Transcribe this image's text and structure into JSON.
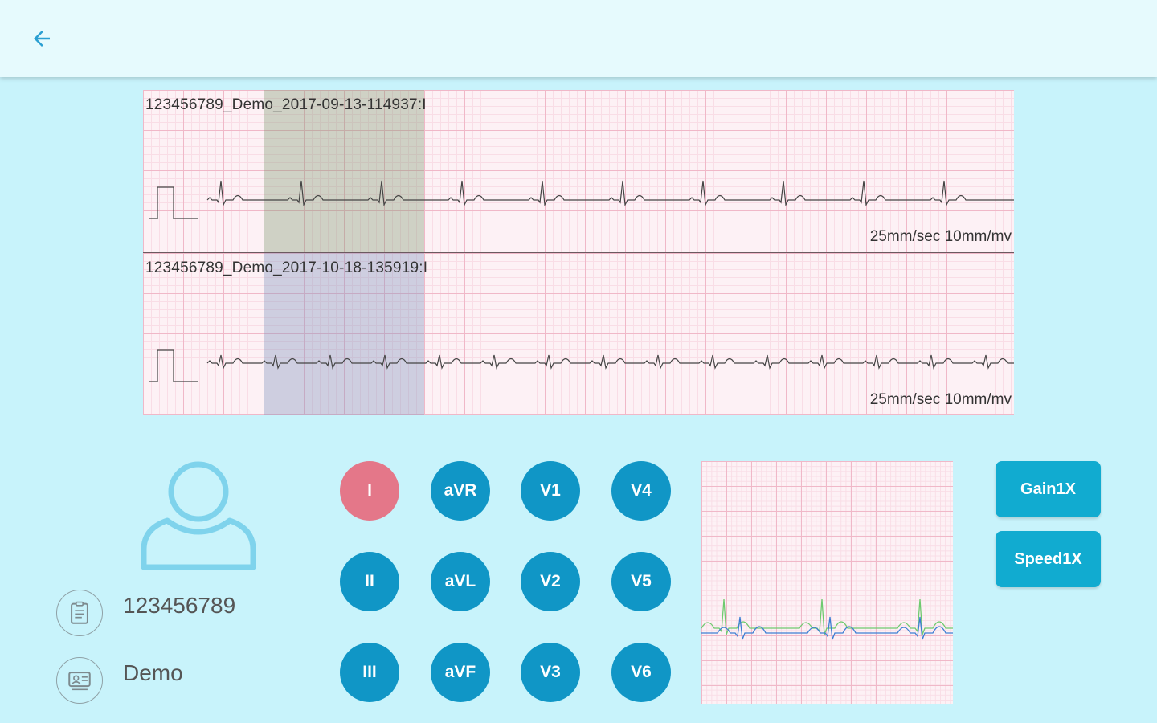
{
  "toolbar": {
    "back_icon": "arrow-left-icon"
  },
  "recordings": [
    {
      "label": "123456789_Demo_2017-09-13-114937:I",
      "scale": "25mm/sec 10mm/mv"
    },
    {
      "label": "123456789_Demo_2017-10-18-135919:I",
      "scale": "25mm/sec 10mm/mv"
    }
  ],
  "patient": {
    "avatar_icon": "user-avatar-icon",
    "id_icon": "clipboard-icon",
    "id": "123456789",
    "name_icon": "id-card-icon",
    "name": "Demo"
  },
  "leads": {
    "selected": "I",
    "rows": [
      [
        "I",
        "aVR",
        "V1",
        "V4"
      ],
      [
        "II",
        "aVL",
        "V2",
        "V5"
      ],
      [
        "III",
        "aVF",
        "V3",
        "V6"
      ]
    ]
  },
  "controls": {
    "gain": "Gain1X",
    "speed": "Speed1X"
  },
  "colors": {
    "accent": "#1096c6",
    "selected_lead": "#e47789",
    "button": "#11abd0",
    "background": "#c8f3fb"
  }
}
